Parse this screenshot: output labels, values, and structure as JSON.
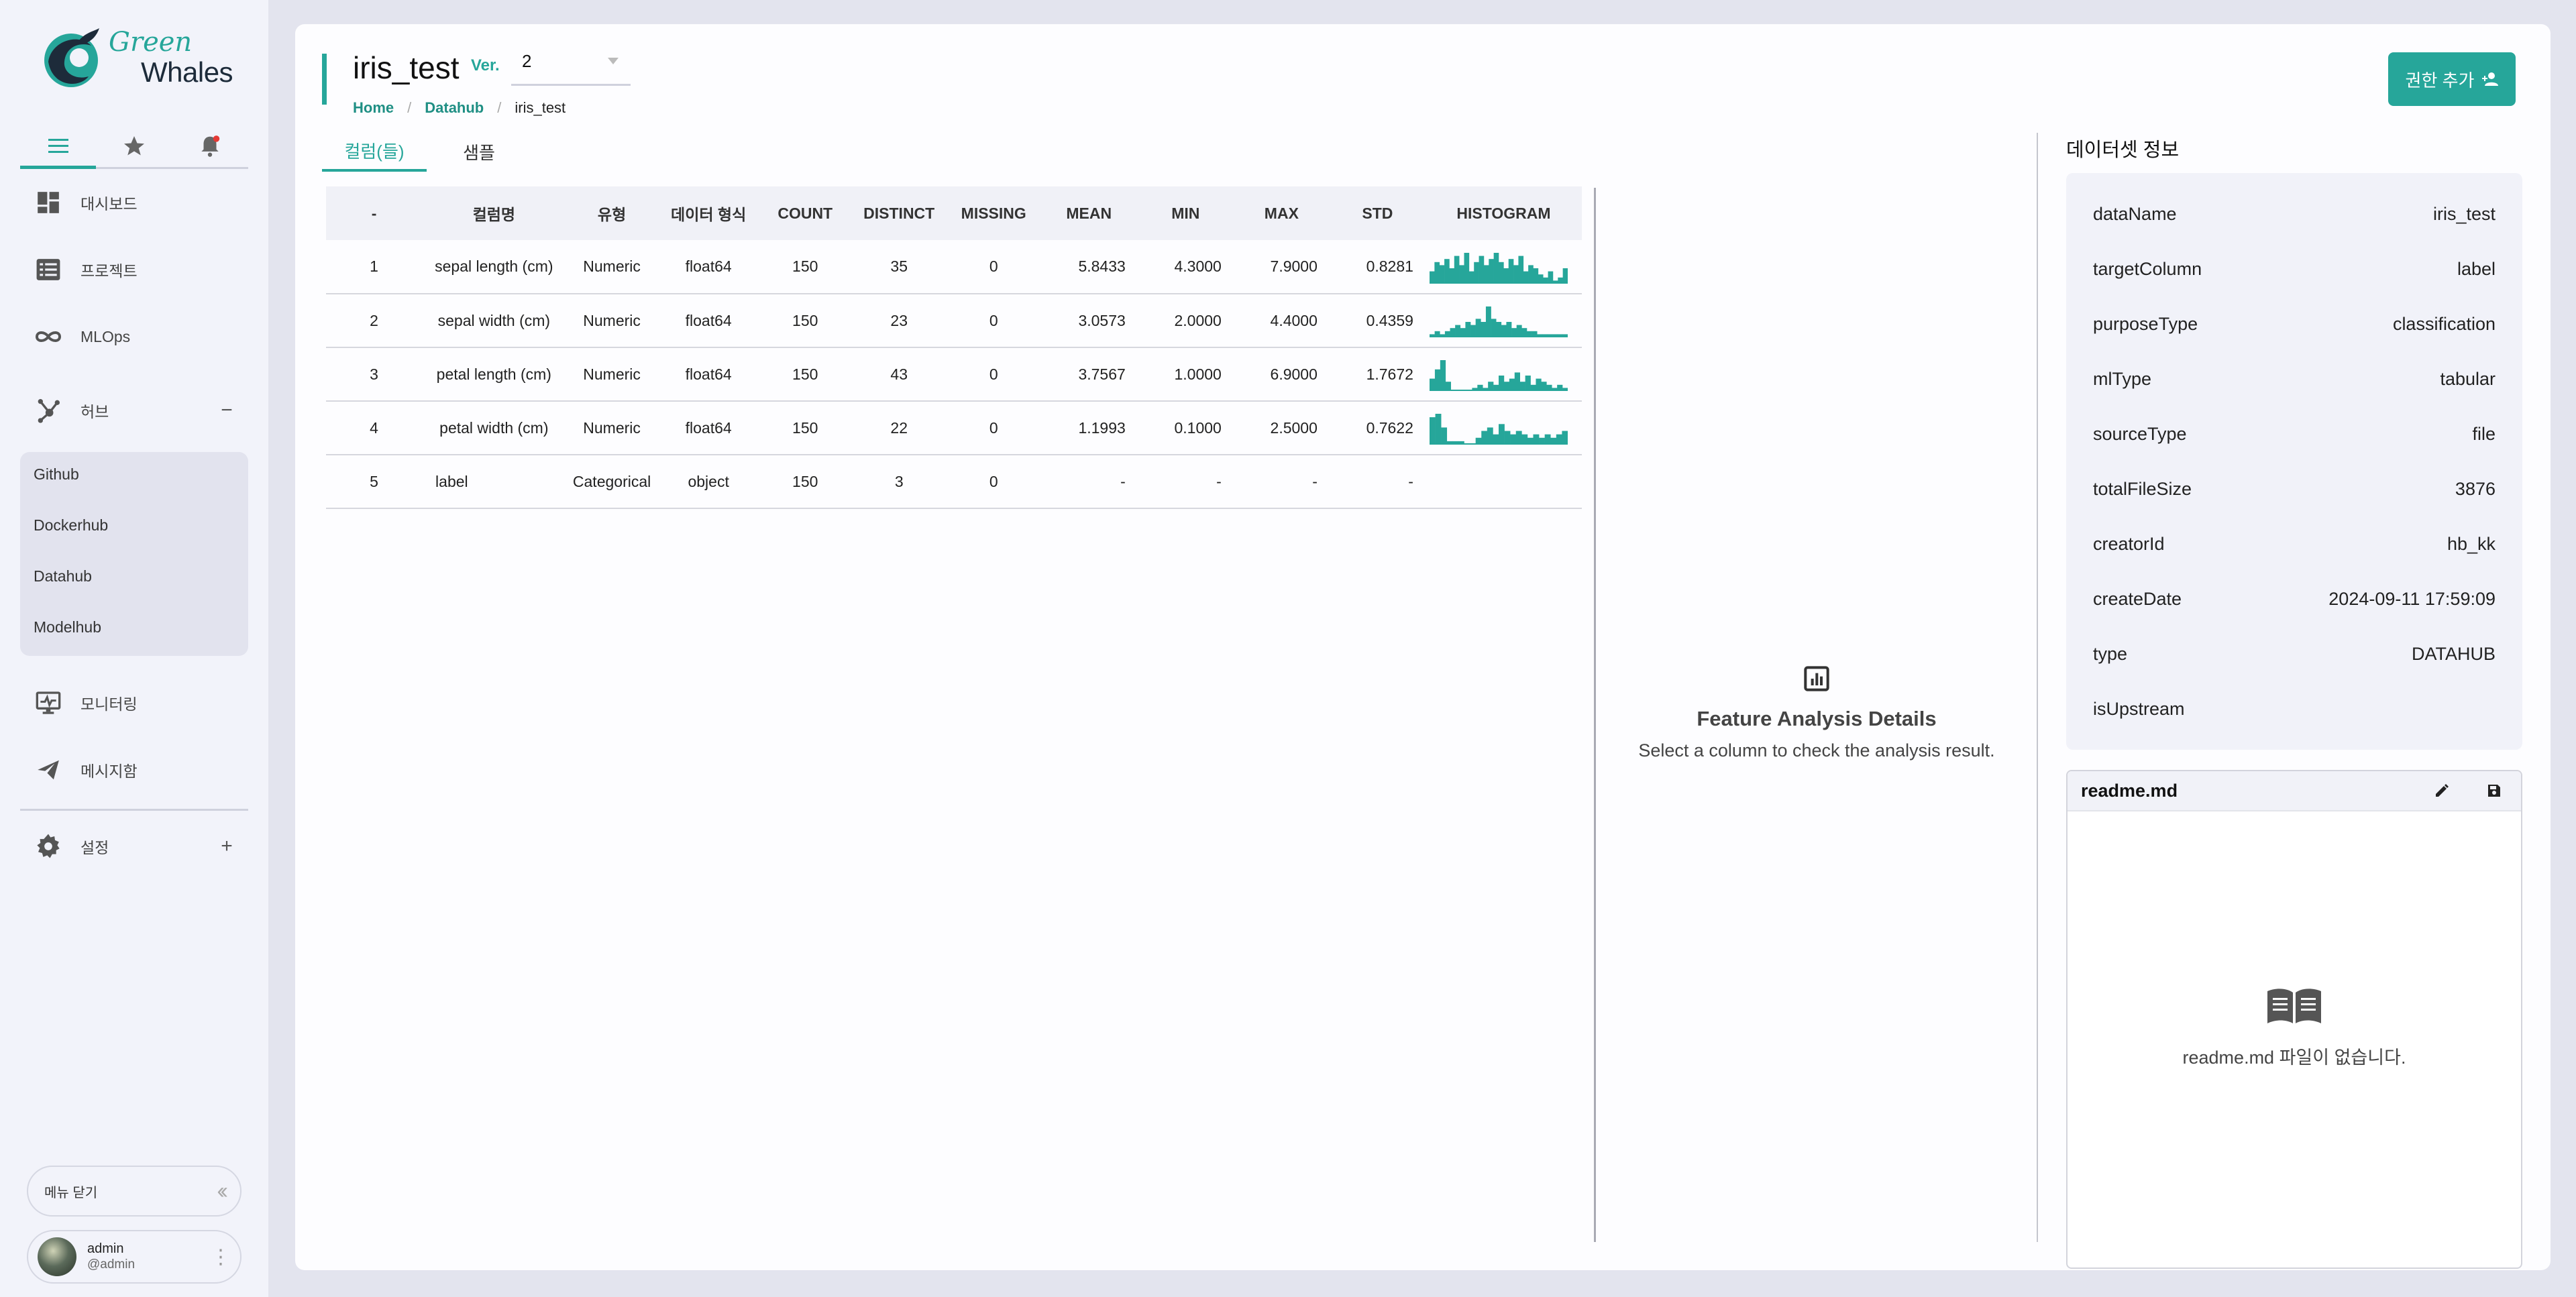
{
  "brand": {
    "line1": "Green",
    "line2": "Whales"
  },
  "sidebar": {
    "nav": [
      {
        "label": "대시보드",
        "icon": "dashboard-icon"
      },
      {
        "label": "프로젝트",
        "icon": "list-icon"
      },
      {
        "label": "MLOps",
        "icon": "infinity-icon"
      },
      {
        "label": "허브",
        "icon": "hub-icon",
        "toggle": "−"
      },
      {
        "label": "모니터링",
        "icon": "monitor-icon"
      },
      {
        "label": "메시지함",
        "icon": "send-icon"
      },
      {
        "label": "설정",
        "icon": "gear-icon",
        "toggle": "+"
      }
    ],
    "hub_items": [
      "Github",
      "Dockerhub",
      "Datahub",
      "Modelhub"
    ],
    "menu_close": "메뉴 닫기",
    "user": {
      "name": "admin",
      "handle": "@admin"
    }
  },
  "header": {
    "title": "iris_test",
    "ver_label": "Ver.",
    "version": "2",
    "breadcrumb": [
      "Home",
      "Datahub",
      "iris_test"
    ],
    "perm_button": "권한 추가"
  },
  "tabs": [
    "컬럼(들)",
    "샘플"
  ],
  "table": {
    "columns": [
      "-",
      "컬럼명",
      "유형",
      "데이터 형식",
      "COUNT",
      "DISTINCT",
      "MISSING",
      "MEAN",
      "MIN",
      "MAX",
      "STD",
      "HISTOGRAM"
    ],
    "rows": [
      [
        "1",
        "sepal length (cm)",
        "Numeric",
        "float64",
        "150",
        "35",
        "0",
        "5.8433",
        "4.3000",
        "7.9000",
        "0.8281"
      ],
      [
        "2",
        "sepal width (cm)",
        "Numeric",
        "float64",
        "150",
        "23",
        "0",
        "3.0573",
        "2.0000",
        "4.4000",
        "0.4359"
      ],
      [
        "3",
        "petal length (cm)",
        "Numeric",
        "float64",
        "150",
        "43",
        "0",
        "3.7567",
        "1.0000",
        "6.9000",
        "1.7672"
      ],
      [
        "4",
        "petal width (cm)",
        "Numeric",
        "float64",
        "150",
        "22",
        "0",
        "1.1993",
        "0.1000",
        "2.5000",
        "0.7622"
      ],
      [
        "5",
        "label",
        "Categorical",
        "object",
        "150",
        "3",
        "0",
        "-",
        "-",
        "-",
        "-"
      ]
    ],
    "histograms": [
      [
        4,
        7,
        6,
        8,
        5,
        9,
        6,
        10,
        4,
        7,
        9,
        6,
        8,
        10,
        7,
        5,
        8,
        6,
        9,
        4,
        6,
        5,
        3,
        2,
        4,
        1,
        2,
        5
      ],
      [
        1,
        2,
        1,
        2,
        3,
        4,
        3,
        5,
        4,
        6,
        5,
        10,
        6,
        5,
        4,
        5,
        3,
        4,
        3,
        2,
        2,
        1,
        1,
        1,
        1,
        1,
        1
      ],
      [
        4,
        7,
        10,
        3,
        0,
        0,
        0,
        0,
        1,
        2,
        1,
        3,
        2,
        5,
        3,
        4,
        6,
        3,
        5,
        2,
        4,
        3,
        2,
        1,
        2,
        1
      ],
      [
        8,
        9,
        5,
        1,
        1,
        1,
        0,
        0,
        2,
        4,
        5,
        3,
        6,
        4,
        3,
        4,
        3,
        2,
        3,
        2,
        3,
        2,
        3,
        4
      ]
    ]
  },
  "feature": {
    "title": "Feature Analysis Details",
    "subtitle": "Select a column to check the analysis result."
  },
  "dataset": {
    "heading": "데이터셋 정보",
    "rows": [
      [
        "dataName",
        "iris_test"
      ],
      [
        "targetColumn",
        "label"
      ],
      [
        "purposeType",
        "classification"
      ],
      [
        "mlType",
        "tabular"
      ],
      [
        "sourceType",
        "file"
      ],
      [
        "totalFileSize",
        "3876"
      ],
      [
        "creatorId",
        "hb_kk"
      ],
      [
        "createDate",
        "2024-09-11 17:59:09"
      ],
      [
        "type",
        "DATAHUB"
      ],
      [
        "isUpstream",
        ""
      ]
    ]
  },
  "readme": {
    "title": "readme.md",
    "empty_message": "readme.md 파일이 없습니다."
  },
  "colors": {
    "accent": "#26a69a",
    "bg": "#e3e4ee",
    "sidebar": "#f2f3fa"
  }
}
